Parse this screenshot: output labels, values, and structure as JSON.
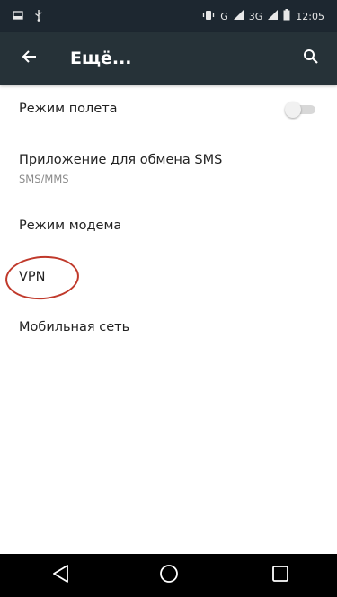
{
  "status_bar": {
    "network": "G",
    "network2": "3G",
    "time": "12:05"
  },
  "app_bar": {
    "title": "Ещё..."
  },
  "settings": {
    "items": [
      {
        "title": "Режим полета",
        "toggle_on": false
      },
      {
        "title": "Приложение для обмена SMS",
        "subtitle": "SMS/MMS"
      },
      {
        "title": "Режим модема"
      },
      {
        "title": "VPN",
        "highlighted": true
      },
      {
        "title": "Мобильная сеть"
      }
    ]
  },
  "colors": {
    "status_bar": "#1d2730",
    "app_bar": "#263238",
    "highlight_circle": "#c0392b"
  },
  "icons": {
    "back": "arrow-left-icon",
    "search": "search-icon",
    "nav_back": "triangle-back-icon",
    "nav_home": "circle-home-icon",
    "nav_recents": "square-recents-icon"
  }
}
